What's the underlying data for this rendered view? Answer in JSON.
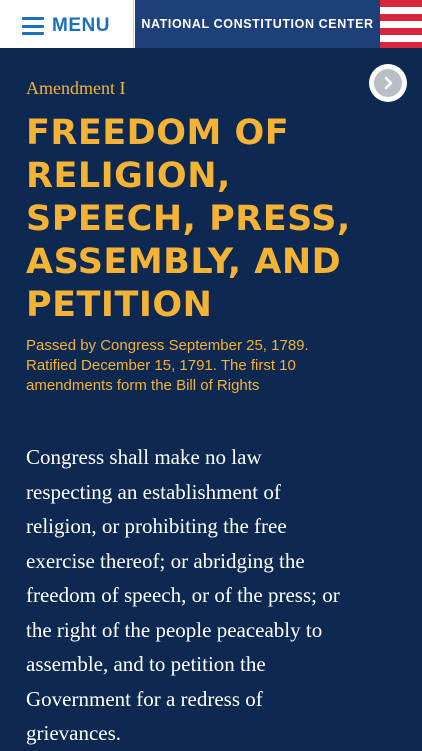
{
  "header": {
    "menu_label": "MENU",
    "brand": "NATIONAL CONSTITUTION CENTER",
    "flag_colors": [
      "#d8263c",
      "#ffffff"
    ]
  },
  "nav": {
    "next_icon": "chevron-right-icon"
  },
  "amendment": {
    "label": "Amendment I",
    "title": "FREEDOM OF\nRELIGION,\nSPEECH, PRESS,\nASSEMBLY, AND\nPETITION",
    "meta": "Passed by Congress September 25, 1789.\nRatified December 15, 1791. The first 10\namendments form the Bill of Rights",
    "text": "Congress shall make no law\nrespecting an establishment of\nreligion, or prohibiting the free\nexercise thereof; or abridging the\nfreedom of speech, or of the press; or\nthe right of the people peaceably to\nassemble, and to petition the\nGovernment for a redress of\ngrievances."
  },
  "colors": {
    "background": "#0d2851",
    "accent": "#f5b335",
    "menu_blue": "#1b70bd",
    "brand_blue": "#1d3f7a"
  }
}
